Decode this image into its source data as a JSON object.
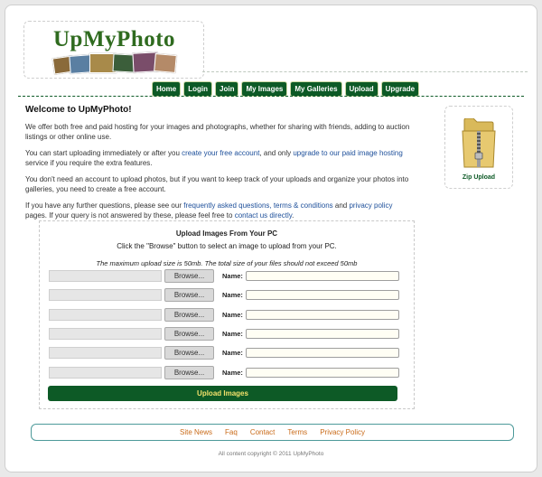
{
  "logo": {
    "text": "UpMyPhoto"
  },
  "nav": {
    "items": [
      "Home",
      "Login",
      "Join",
      "My Images",
      "My Galleries",
      "Upload",
      "Upgrade"
    ]
  },
  "welcome": {
    "title": "Welcome to UpMyPhoto!",
    "p1": "We offer both free and paid hosting for your images and photographs, whether for sharing with friends, adding to auction listings or other online use.",
    "p2_pre": "You can start uploading immediately or after you ",
    "p2_link1": "create your free account",
    "p2_mid": ", and only ",
    "p2_link2": "upgrade to our paid image hosting",
    "p2_post": " service if you require the extra features.",
    "p3": "You don't need an account to upload photos, but if you want to keep track of your uploads and organize your photos into galleries, you need to create a free account.",
    "p4_pre": "If you have any further questions, please see our ",
    "p4_link1": "frequently asked questions, terms & conditions",
    "p4_mid": " and ",
    "p4_link2": "privacy policy",
    "p4_mid2": " pages. If your query is not answered by these, please feel free to ",
    "p4_link3": "contact us directly",
    "p4_post": "."
  },
  "zip": {
    "label": "Zip Upload",
    "icon": "zip-folder-icon"
  },
  "upload": {
    "title": "Upload Images From Your PC",
    "subtitle": "Click the \"Browse\" button to select an image to upload from your PC.",
    "note": "The maximum upload size is 50mb. The total size of your files should not exceed 50mb",
    "browse_label": "Browse...",
    "name_label": "Name:",
    "rows": 6,
    "button_label": "Upload Images"
  },
  "footer": {
    "links": [
      "Site News",
      "Faq",
      "Contact",
      "Terms",
      "Privacy Policy"
    ],
    "copyright": "All content copyright © 2011 UpMyPhoto"
  },
  "colors": {
    "accent": "#0d5a26",
    "button_text": "#f2e16b",
    "link": "#1d4f9a",
    "footer_link": "#c96b19"
  }
}
